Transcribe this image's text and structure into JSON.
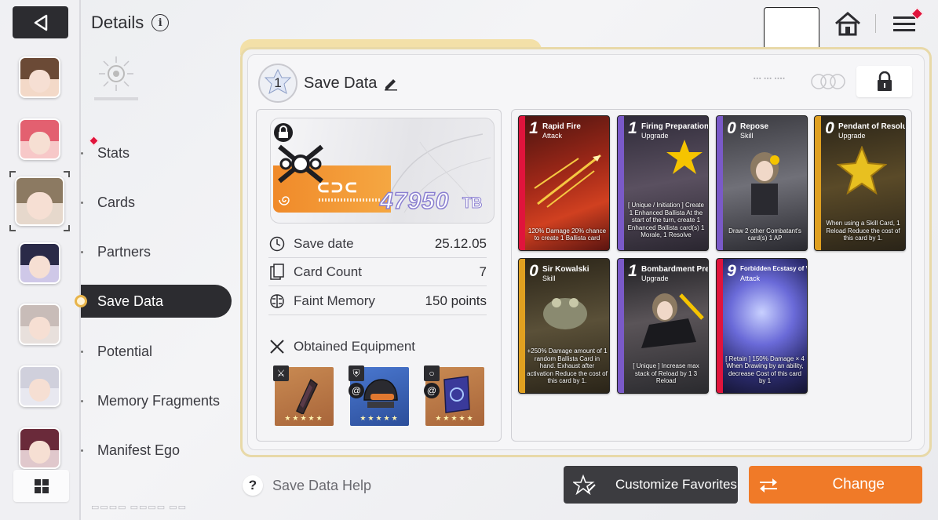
{
  "header": {
    "title": "Details"
  },
  "menu": {
    "items": [
      {
        "label": "Stats"
      },
      {
        "label": "Cards"
      },
      {
        "label": "Partners"
      },
      {
        "label": "Save Data"
      },
      {
        "label": "Potential"
      },
      {
        "label": "Memory Fragments"
      },
      {
        "label": "Manifest Ego"
      }
    ],
    "active": "Save Data"
  },
  "save": {
    "slot": "1",
    "title": "Save Data",
    "amount": "47950",
    "unit": "TB",
    "stats": [
      {
        "label": "Save date",
        "value": "25.12.05",
        "icon": "clock-icon"
      },
      {
        "label": "Card Count",
        "value": "7",
        "icon": "card-count-icon"
      },
      {
        "label": "Faint Memory",
        "value": "150 points",
        "icon": "brain-icon"
      }
    ],
    "equipment_title": "Obtained Equipment",
    "equipment": [
      {
        "icon": "weapon-icon",
        "stars": "★★★★★",
        "color": "#b8733e"
      },
      {
        "icon": "armor-icon",
        "stars": "★★★★★",
        "color": "#3a64b8"
      },
      {
        "icon": "ring-icon",
        "stars": "★★★★★",
        "color": "#b8733e"
      }
    ]
  },
  "cards": [
    {
      "cost": "1",
      "name": "Rapid Fire",
      "type": "Attack",
      "stripe": "#e0143c",
      "bg": "#8a1a10",
      "desc": "120% Damage 20% chance to create 1 Ballista card"
    },
    {
      "cost": "1",
      "name": "Firing Preparation",
      "type": "Upgrade",
      "stripe": "#7a5ac8",
      "bg": "#3e3848",
      "desc": "[ Unique / Initiation ] Create 1 Enhanced Ballista At the start of the turn, create 1 Enhanced Ballista card(s) 1 Morale, 1 Resolve"
    },
    {
      "cost": "0",
      "name": "Repose",
      "type": "Skill",
      "stripe": "#7a5ac8",
      "bg": "#4a4a50",
      "desc": "Draw 2 other Combatant's card(s) 1 AP"
    },
    {
      "cost": "0",
      "name": "Pendant of Resolution",
      "type": "Upgrade",
      "stripe": "#e0a020",
      "bg": "#3a3020",
      "desc": "When using a Skill Card, 1 Reload Reduce the cost of this card by 1."
    },
    {
      "cost": "0",
      "name": "Sir Kowalski",
      "type": "Skill",
      "stripe": "#e0a020",
      "bg": "#3a3020",
      "desc": "+250% Damage amount of 1 random Ballista Card in hand. Exhaust after activation Reduce the cost of this card by 1."
    },
    {
      "cost": "1",
      "name": "Bombardment Prep",
      "type": "Upgrade",
      "stripe": "#7a5ac8",
      "bg": "#2e2e32",
      "desc": "[ Unique ] Increase max stack of Reload by 1 3 Reload"
    },
    {
      "cost": "9",
      "name": "Forbidden Ecstasy of Violence",
      "type": "Attack",
      "stripe": "#e0143c",
      "bg": "#2a2a5a",
      "desc": "[ Retain ] 150% Damage × 4 When Drawing by an ability, decrease Cost of this card by 1"
    }
  ],
  "footer": {
    "help": "Save Data Help",
    "favorites": "Customize Favorites",
    "change": "Change"
  },
  "colors": {
    "accent_orange": "#f07a28",
    "dark": "#2c2c30",
    "alert_red": "#e0143c"
  }
}
